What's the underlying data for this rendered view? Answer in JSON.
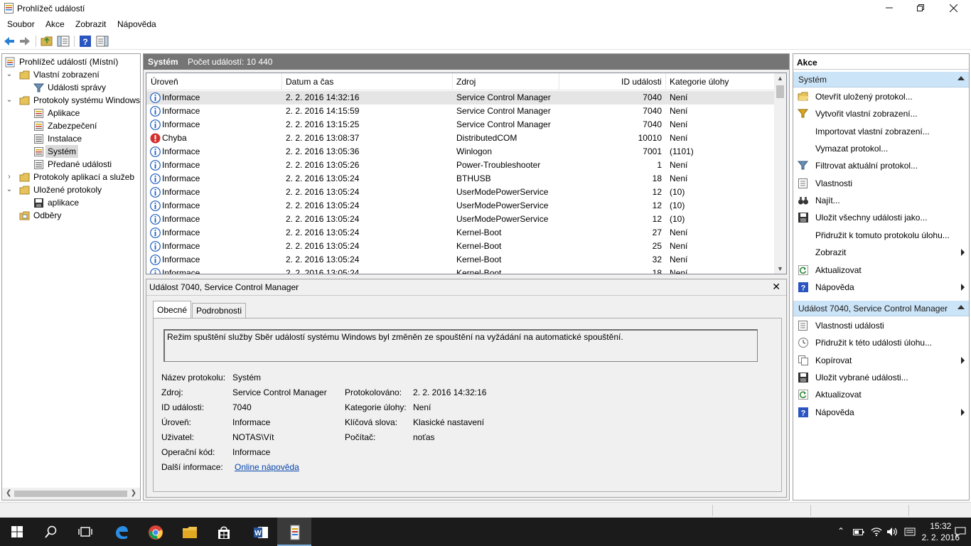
{
  "window": {
    "title": "Prohlížeč událostí"
  },
  "menu": [
    "Soubor",
    "Akce",
    "Zobrazit",
    "Nápověda"
  ],
  "tree": {
    "root": "Prohlížeč událostí (Místní)",
    "custom_views": "Vlastní zobrazení",
    "admin_events": "Události správy",
    "windows_logs": "Protokoly systému Windows",
    "application": "Aplikace",
    "security": "Zabezpečení",
    "setup": "Instalace",
    "system": "Systém",
    "forwarded": "Předané události",
    "app_service_logs": "Protokoly aplikací a služeb",
    "saved_logs": "Uložené protokoly",
    "saved_app": "aplikace",
    "subscriptions": "Odběry"
  },
  "center": {
    "log_name": "Systém",
    "event_count": "Počet událostí: 10 440",
    "columns": [
      "Úroveň",
      "Datum a čas",
      "Zdroj",
      "ID události",
      "Kategorie úlohy"
    ],
    "rows": [
      {
        "level": "Informace",
        "type": "info",
        "date": "2. 2. 2016 14:32:16",
        "source": "Service Control Manager",
        "id": "7040",
        "category": "Není"
      },
      {
        "level": "Informace",
        "type": "info",
        "date": "2. 2. 2016 14:15:59",
        "source": "Service Control Manager",
        "id": "7040",
        "category": "Není"
      },
      {
        "level": "Informace",
        "type": "info",
        "date": "2. 2. 2016 13:15:25",
        "source": "Service Control Manager",
        "id": "7040",
        "category": "Není"
      },
      {
        "level": "Chyba",
        "type": "error",
        "date": "2. 2. 2016 13:08:37",
        "source": "DistributedCOM",
        "id": "10010",
        "category": "Není"
      },
      {
        "level": "Informace",
        "type": "info",
        "date": "2. 2. 2016 13:05:36",
        "source": "Winlogon",
        "id": "7001",
        "category": "(1101)"
      },
      {
        "level": "Informace",
        "type": "info",
        "date": "2. 2. 2016 13:05:26",
        "source": "Power-Troubleshooter",
        "id": "1",
        "category": "Není"
      },
      {
        "level": "Informace",
        "type": "info",
        "date": "2. 2. 2016 13:05:24",
        "source": "BTHUSB",
        "id": "18",
        "category": "Není"
      },
      {
        "level": "Informace",
        "type": "info",
        "date": "2. 2. 2016 13:05:24",
        "source": "UserModePowerService",
        "id": "12",
        "category": "(10)"
      },
      {
        "level": "Informace",
        "type": "info",
        "date": "2. 2. 2016 13:05:24",
        "source": "UserModePowerService",
        "id": "12",
        "category": "(10)"
      },
      {
        "level": "Informace",
        "type": "info",
        "date": "2. 2. 2016 13:05:24",
        "source": "UserModePowerService",
        "id": "12",
        "category": "(10)"
      },
      {
        "level": "Informace",
        "type": "info",
        "date": "2. 2. 2016 13:05:24",
        "source": "Kernel-Boot",
        "id": "27",
        "category": "Není"
      },
      {
        "level": "Informace",
        "type": "info",
        "date": "2. 2. 2016 13:05:24",
        "source": "Kernel-Boot",
        "id": "25",
        "category": "Není"
      },
      {
        "level": "Informace",
        "type": "info",
        "date": "2. 2. 2016 13:05:24",
        "source": "Kernel-Boot",
        "id": "32",
        "category": "Není"
      },
      {
        "level": "Informace",
        "type": "info",
        "date": "2. 2. 2016 13:05:24",
        "source": "Kernel-Boot",
        "id": "18",
        "category": "Není"
      }
    ]
  },
  "detail": {
    "title": "Událost 7040, Service Control Manager",
    "tab_general": "Obecné",
    "tab_details": "Podrobnosti",
    "description": "Režim spuštění služby Sběr událostí systému Windows byl změněn ze spouštění na vyžádání na automatické spouštění.",
    "log_name_label": "Název protokolu:",
    "log_name_value": "Systém",
    "source_label": "Zdroj:",
    "source_value": "Service Control Manager",
    "event_id_label": "ID události:",
    "event_id_value": "7040",
    "level_label": "Úroveň:",
    "level_value": "Informace",
    "user_label": "Uživatel:",
    "user_value": "NOTAS\\Vít",
    "opcode_label": "Operační kód:",
    "opcode_value": "Informace",
    "more_info_label": "Další informace:",
    "more_info_link": "Online nápověda",
    "logged_label": "Protokolováno:",
    "logged_value": "2. 2. 2016 14:32:16",
    "task_category_label": "Kategorie úlohy:",
    "task_category_value": "Není",
    "keywords_label": "Klíčová slova:",
    "keywords_value": "Klasické nastavení",
    "computer_label": "Počítač:",
    "computer_value": "noťas"
  },
  "actions": {
    "header": "Akce",
    "section1": "Systém",
    "items1": [
      {
        "label": "Otevřít uložený protokol...",
        "icon": "folder-open-icon",
        "sub": false
      },
      {
        "label": "Vytvořit vlastní zobrazení...",
        "icon": "filter-create-icon",
        "sub": false
      },
      {
        "label": "Importovat vlastní zobrazení...",
        "icon": "",
        "sub": false
      },
      {
        "label": "Vymazat protokol...",
        "icon": "",
        "sub": false
      },
      {
        "label": "Filtrovat aktuální protokol...",
        "icon": "filter-icon",
        "sub": false
      },
      {
        "label": "Vlastnosti",
        "icon": "properties-icon",
        "sub": false
      },
      {
        "label": "Najít...",
        "icon": "binoculars-icon",
        "sub": false
      },
      {
        "label": "Uložit všechny události jako...",
        "icon": "save-icon",
        "sub": false
      },
      {
        "label": "Přidružit k tomuto protokolu úlohu...",
        "icon": "",
        "sub": false
      },
      {
        "label": "Zobrazit",
        "icon": "",
        "sub": true
      },
      {
        "label": "Aktualizovat",
        "icon": "refresh-icon",
        "sub": false
      },
      {
        "label": "Nápověda",
        "icon": "help-icon",
        "sub": true
      }
    ],
    "section2": "Událost 7040, Service Control Manager",
    "items2": [
      {
        "label": "Vlastnosti události",
        "icon": "properties-icon",
        "sub": false
      },
      {
        "label": "Přidružit k této události úlohu...",
        "icon": "task-icon",
        "sub": false
      },
      {
        "label": "Kopírovat",
        "icon": "copy-icon",
        "sub": true
      },
      {
        "label": "Uložit vybrané události...",
        "icon": "save-icon",
        "sub": false
      },
      {
        "label": "Aktualizovat",
        "icon": "refresh-icon",
        "sub": false
      },
      {
        "label": "Nápověda",
        "icon": "help-icon",
        "sub": true
      }
    ]
  },
  "taskbar": {
    "time": "15:32",
    "date": "2. 2. 2016"
  },
  "colors": {
    "accent": "#0078d7",
    "selection": "#cce4f7",
    "error": "#d32f2f",
    "info": "#1f5fbf"
  }
}
